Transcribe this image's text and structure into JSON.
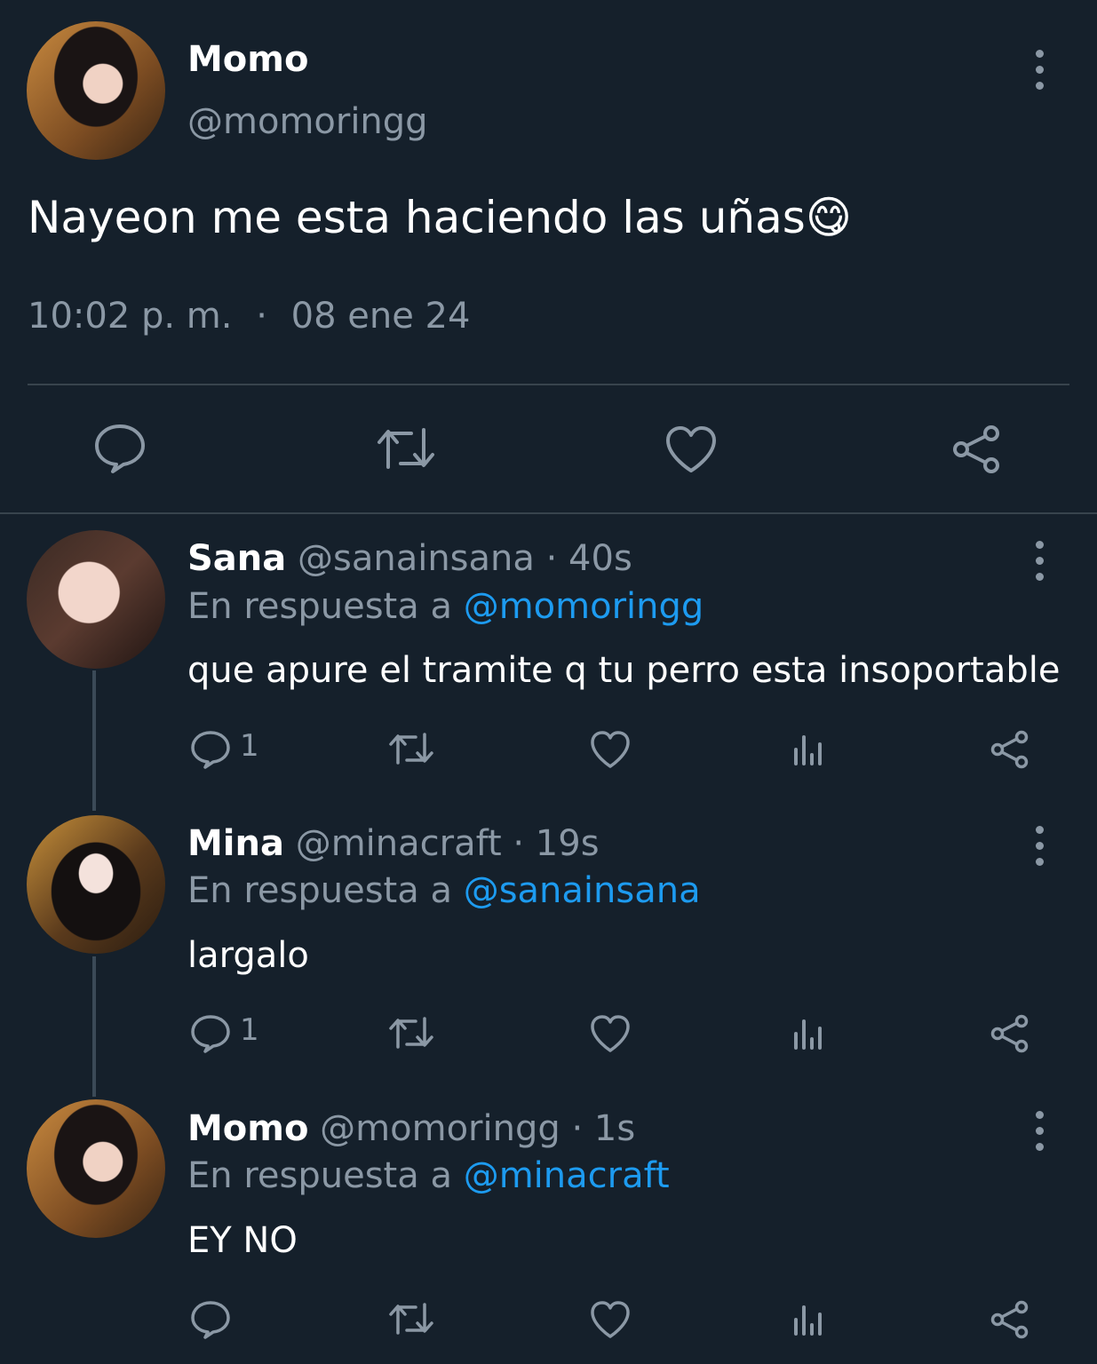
{
  "main_tweet": {
    "name": "Momo",
    "handle": "@momoringg",
    "text": "Nayeon me esta haciendo las uñas",
    "emoji": "😋",
    "time": "10:02 p. m.",
    "separator": "·",
    "date": "08 ene 24"
  },
  "replies": [
    {
      "name": "Sana",
      "handle": "@sanainsana",
      "age": "· 40s",
      "reply_prefix": "En respuesta a",
      "reply_to": "@momoringg",
      "text": "que apure el tramite q tu perro esta insoportable",
      "reply_count": "1"
    },
    {
      "name": "Mina",
      "handle": "@minacraft",
      "age": "· 19s",
      "reply_prefix": "En respuesta a",
      "reply_to": "@sanainsana",
      "text": "largalo",
      "reply_count": "1"
    },
    {
      "name": "Momo",
      "handle": "@momoringg",
      "age": "· 1s",
      "reply_prefix": "En respuesta a",
      "reply_to": "@minacraft",
      "text": "EY NO",
      "reply_count": ""
    }
  ],
  "icons": {
    "reply": "reply-icon",
    "retweet": "retweet-icon",
    "like": "heart-icon",
    "views": "views-icon",
    "share": "share-icon",
    "more": "more-icon"
  },
  "colors": {
    "background": "#15202b",
    "text": "#ffffff",
    "muted": "#8b98a5",
    "link": "#1d9bf0",
    "divider": "#38444d"
  }
}
